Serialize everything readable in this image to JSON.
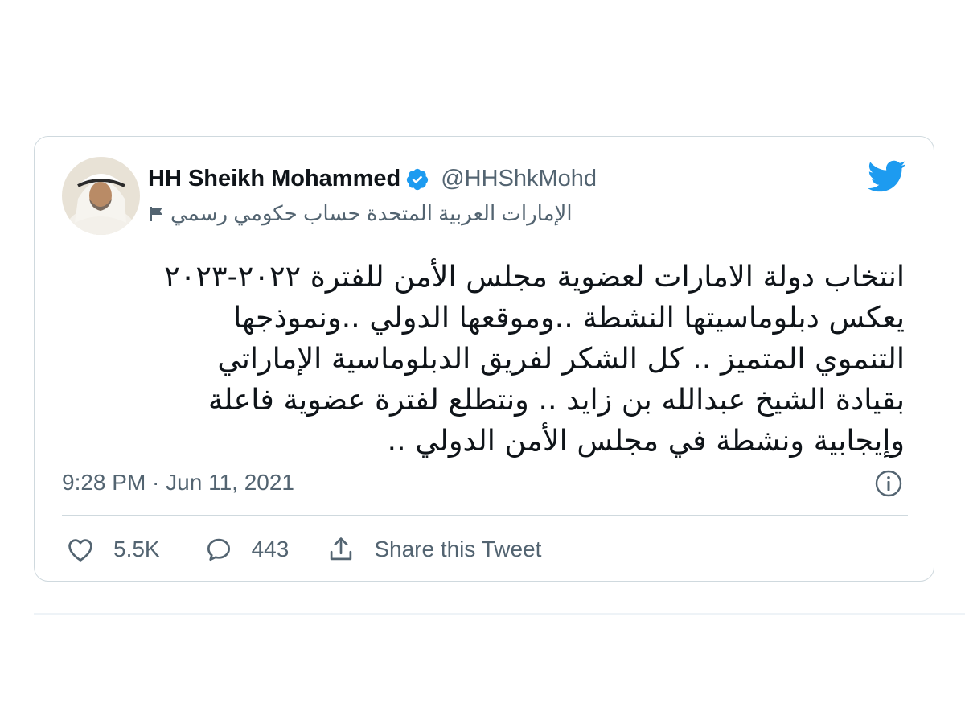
{
  "author": {
    "display_name": "HH Sheikh Mohammed",
    "handle": "@HHShkMohd",
    "verified": true,
    "label": "الإمارات العربية المتحدة حساب حكومي رسمي",
    "avatar_icon": "person-avatar"
  },
  "tweet": {
    "lines": [
      "انتخاب دولة الامارات لعضوية مجلس الأمن للفترة ٢٠٢٢-٢٠٢٣",
      "يعكس دبلوماسيتها  النشطة ..وموقعها الدولي ..ونموذجها",
      "التنموي المتميز .. كل الشكر لفريق الدبلوماسية الإماراتي",
      "بقيادة الشيخ عبدالله بن زايد  .. ونتطلع لفترة عضوية فاعلة",
      "وإيجابية ونشطة في مجلس الأمن الدولي  .."
    ],
    "timestamp": "9:28 PM · Jun 11, 2021"
  },
  "actions": {
    "like_count": "5.5K",
    "reply_count": "443",
    "share_label": "Share this Tweet"
  },
  "icons": {
    "verified": "verified-badge-icon",
    "brand": "twitter-bird-icon",
    "info": "info-icon",
    "like": "heart-icon",
    "reply": "speech-bubble-icon",
    "share": "share-upload-icon",
    "flag": "flag-icon"
  },
  "colors": {
    "brand_blue": "#1d9bf0",
    "text_primary": "#0f1419",
    "text_secondary": "#536471",
    "border": "#cfd9de"
  }
}
